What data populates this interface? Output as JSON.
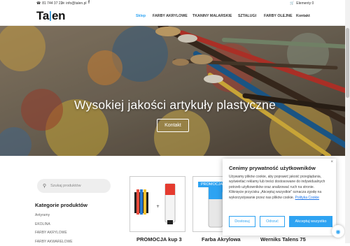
{
  "topbar": {
    "phone": "81 744 37 22",
    "email": "info@talen.pl",
    "facebook": "f",
    "cart": "Elementy 0"
  },
  "logo": {
    "left": "Ta",
    "right": "en"
  },
  "nav": [
    {
      "label": "Sklep",
      "active": true
    },
    {
      "label": "FARBY AKRYLOWE"
    },
    {
      "label": "TKANINY MALARSKIE"
    },
    {
      "label": "SZTALUGI"
    },
    {
      "label": "FARBY OLEJNE"
    },
    {
      "label": "Kontakt"
    }
  ],
  "hero": {
    "title": "Wysokiej jakości artykuły plastyczne",
    "button": "Kontakt"
  },
  "search": {
    "placeholder": "Szukaj produktów"
  },
  "categories": {
    "title": "Kategorie produktów",
    "items": [
      "Antyramy",
      "EKOLINA",
      "FARBY AKRYLOWE",
      "FARBY AKWARELOWE"
    ]
  },
  "products": [
    {
      "title": "PROMOCJA kup 3"
    },
    {
      "title": "Farba Akrylowa",
      "badge": "PROMOCJA"
    },
    {
      "title": "Werniks Talens 75"
    }
  ],
  "cookie": {
    "title": "Cenimy prywatność użytkowników",
    "text": "Używamy plików cookie, aby poprawić jakość przeglądania, wyświetlać reklamy lub treści dostosowane do indywidualnych potrzeb użytkowników oraz analizować ruch na stronie. Kliknięcie przycisku „Akceptuj wszystkie\" oznacza zgodę na wykorzystywanie przez nas plików cookie.",
    "policy_link": "Polityka Cookie",
    "close": "×",
    "buttons": {
      "customize": "Dostosuj",
      "reject": "Odrzuć",
      "accept": "Akceptuj wszystko"
    }
  },
  "colors": {
    "accent": "#2ea3f2",
    "logo_bar": "#4aa3df"
  }
}
